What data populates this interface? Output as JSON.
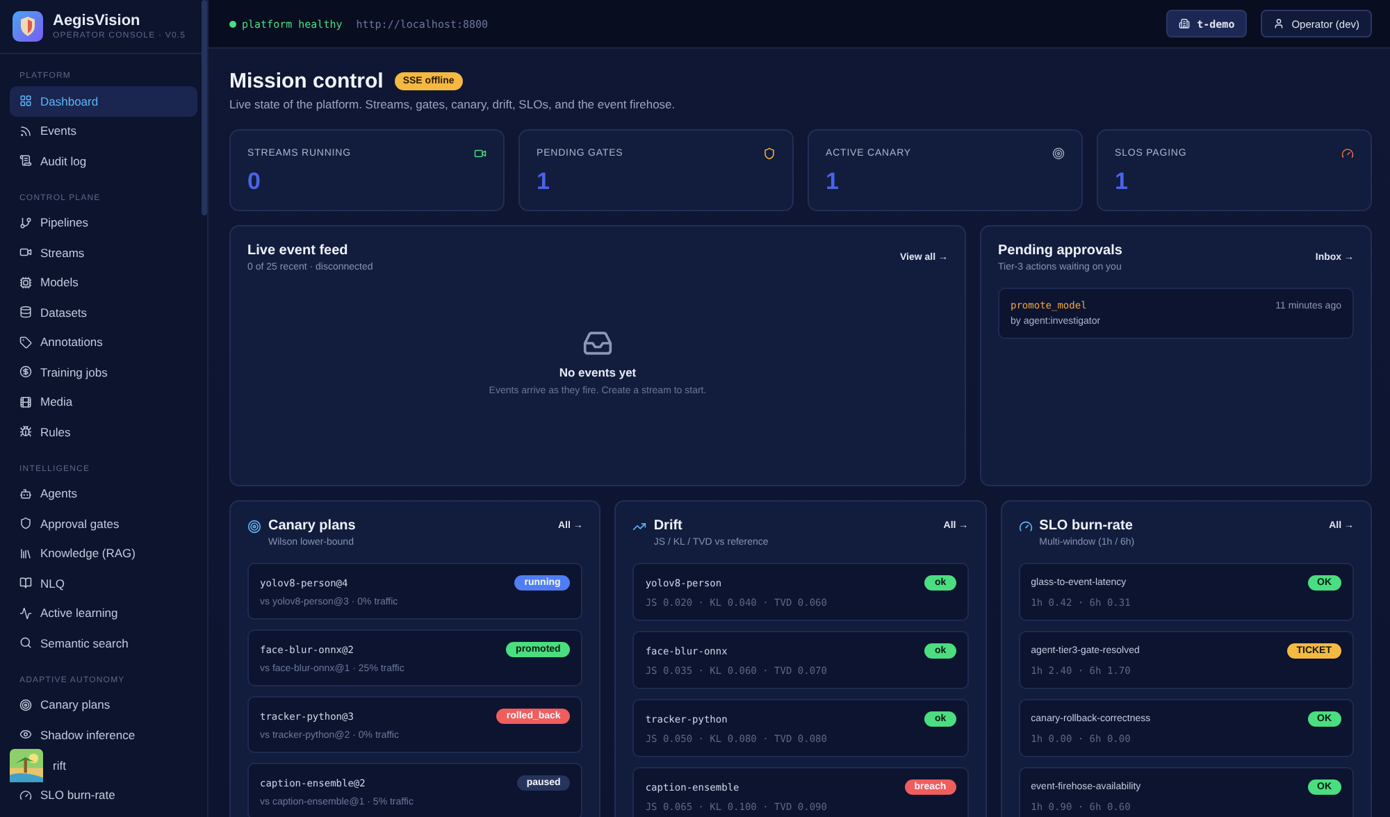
{
  "brand": {
    "name": "AegisVision",
    "subtitle": "OPERATOR CONSOLE · V0.5"
  },
  "sidebar": {
    "sections": [
      {
        "title": "PLATFORM",
        "items": [
          {
            "label": "Dashboard",
            "selected": true
          },
          {
            "label": "Events",
            "selected": false
          },
          {
            "label": "Audit log",
            "selected": false
          }
        ]
      },
      {
        "title": "CONTROL PLANE",
        "items": [
          {
            "label": "Pipelines",
            "selected": false
          },
          {
            "label": "Streams",
            "selected": false
          },
          {
            "label": "Models",
            "selected": false
          },
          {
            "label": "Datasets",
            "selected": false
          },
          {
            "label": "Annotations",
            "selected": false
          },
          {
            "label": "Training jobs",
            "selected": false
          },
          {
            "label": "Media",
            "selected": false
          },
          {
            "label": "Rules",
            "selected": false
          }
        ]
      },
      {
        "title": "INTELLIGENCE",
        "items": [
          {
            "label": "Agents",
            "selected": false
          },
          {
            "label": "Approval gates",
            "selected": false
          },
          {
            "label": "Knowledge (RAG)",
            "selected": false
          },
          {
            "label": "NLQ",
            "selected": false
          },
          {
            "label": "Active learning",
            "selected": false
          },
          {
            "label": "Semantic search",
            "selected": false
          }
        ]
      },
      {
        "title": "ADAPTIVE AUTONOMY",
        "items": [
          {
            "label": "Canary plans",
            "selected": false
          },
          {
            "label": "Shadow inference",
            "selected": false
          },
          {
            "label": "rift",
            "selected": false,
            "covered": true
          },
          {
            "label": "SLO burn-rate",
            "selected": false
          }
        ]
      }
    ]
  },
  "topbar": {
    "status": "platform healthy",
    "url": "http://localhost:8800",
    "tenant": "t-demo",
    "user": "Operator (dev)"
  },
  "header": {
    "title": "Mission control",
    "badge": "SSE offline",
    "description": "Live state of the platform. Streams, gates, canary, drift, SLOs, and the event firehose."
  },
  "metrics": [
    {
      "label": "STREAMS RUNNING",
      "value": "0"
    },
    {
      "label": "PENDING GATES",
      "value": "1"
    },
    {
      "label": "ACTIVE CANARY",
      "value": "1"
    },
    {
      "label": "SLOS PAGING",
      "value": "1"
    }
  ],
  "event_feed": {
    "title": "Live event feed",
    "subtitle": "0 of 25 recent · disconnected",
    "link": "View all →",
    "empty_title": "No events yet",
    "empty_text": "Events arrive as they fire. Create a stream to start."
  },
  "approvals": {
    "title": "Pending approvals",
    "subtitle": "Tier-3 actions waiting on you",
    "link": "Inbox →",
    "items": [
      {
        "action": "promote_model",
        "time": "11 minutes ago",
        "by": "by agent:investigator"
      }
    ]
  },
  "panels": [
    {
      "title": "Canary plans",
      "subtitle": "Wilson lower-bound",
      "link": "All →",
      "kind": "canary",
      "rows": [
        {
          "name": "yolov8-person@4",
          "detail": "vs yolov8-person@3 · 0% traffic",
          "badge": "running",
          "color": "#4f7df3"
        },
        {
          "name": "face-blur-onnx@2",
          "detail": "vs face-blur-onnx@1 · 25% traffic",
          "badge": "promoted",
          "color": "#4ade80"
        },
        {
          "name": "tracker-python@3",
          "detail": "vs tracker-python@2 · 0% traffic",
          "badge": "rolled_back",
          "color": "#ef5d5d"
        },
        {
          "name": "caption-ensemble@2",
          "detail": "vs caption-ensemble@1 · 5% traffic",
          "badge": "paused",
          "color": "#26335c"
        }
      ]
    },
    {
      "title": "Drift",
      "subtitle": "JS / KL / TVD vs reference",
      "link": "All →",
      "kind": "drift",
      "rows": [
        {
          "name": "yolov8-person",
          "detail": "JS 0.020 · KL 0.040 · TVD 0.060",
          "badge": "ok",
          "color": "#4ade80"
        },
        {
          "name": "face-blur-onnx",
          "detail": "JS 0.035 · KL 0.060 · TVD 0.070",
          "badge": "ok",
          "color": "#4ade80"
        },
        {
          "name": "tracker-python",
          "detail": "JS 0.050 · KL 0.080 · TVD 0.080",
          "badge": "ok",
          "color": "#4ade80"
        },
        {
          "name": "caption-ensemble",
          "detail": "JS 0.065 · KL 0.100 · TVD 0.090",
          "badge": "breach",
          "color": "#ef5d5d"
        }
      ]
    },
    {
      "title": "SLO burn-rate",
      "subtitle": "Multi-window (1h / 6h)",
      "link": "All →",
      "kind": "slo",
      "rows": [
        {
          "name": "glass-to-event-latency",
          "detail": "1h 0.42 · 6h 0.31",
          "badge": "OK",
          "color": "#4ade80"
        },
        {
          "name": "agent-tier3-gate-resolved",
          "detail": "1h 2.40 · 6h 1.70",
          "badge": "TICKET",
          "color": "#f5b942"
        },
        {
          "name": "canary-rollback-correctness",
          "detail": "1h 0.00 · 6h 0.00",
          "badge": "OK",
          "color": "#4ade80"
        },
        {
          "name": "event-firehose-availability",
          "detail": "1h 0.90 · 6h 0.60",
          "badge": "OK",
          "color": "#4ade80"
        }
      ]
    }
  ]
}
